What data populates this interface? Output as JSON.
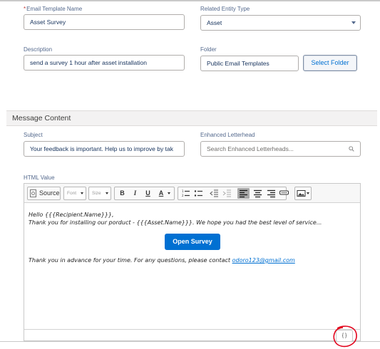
{
  "form": {
    "template_name": {
      "required_mark": "*",
      "label": "Email Template Name",
      "value": "Asset Survey"
    },
    "entity_type": {
      "label": "Related Entity Type",
      "value": "Asset"
    },
    "description": {
      "label": "Description",
      "value": "send a survey 1 hour after asset installation"
    },
    "folder": {
      "label": "Folder",
      "value": "Public Email Templates",
      "button_label": "Select Folder"
    }
  },
  "section": {
    "title": "Message Content"
  },
  "message": {
    "subject": {
      "label": "Subject",
      "value": "Your feedback is important. Help us to improve by tak"
    },
    "letterhead": {
      "label": "Enhanced Letterhead",
      "placeholder": "Search Enhanced Letterheads..."
    },
    "html_value": {
      "label": "HTML Value"
    }
  },
  "toolbar": {
    "source_label": "Source",
    "font_label": "Font",
    "size_label": "Size",
    "bold": "B",
    "italic": "I",
    "underline": "U",
    "text_color": "A"
  },
  "editor": {
    "line1": "Hello  {{{Recipient.Name}}},",
    "line2": "Thank you for installing our porduct - {{{Asset.Name}}}. We hope you had the best level of service...",
    "button_label": "Open Survey",
    "line3_prefix": "Thank you in advance for your time.  For any questions, please contact ",
    "email_link": "odoro123@gmail.com"
  },
  "footer": {
    "merge_button_label": "{ }"
  },
  "colors": {
    "accent": "#0070d2",
    "annotation": "#e2001a"
  }
}
